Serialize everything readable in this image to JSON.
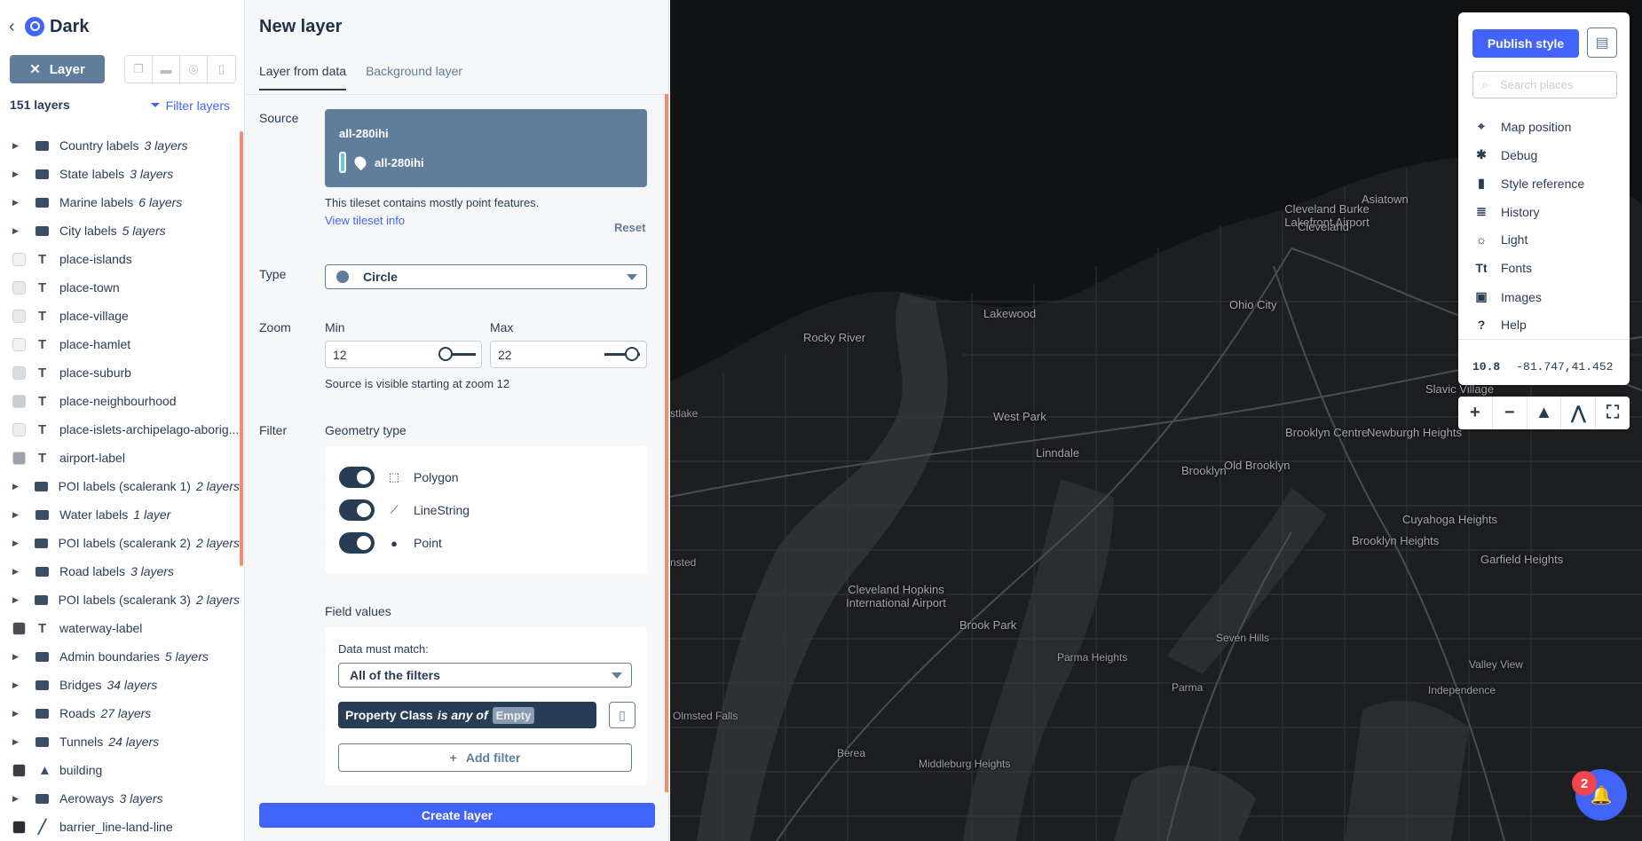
{
  "sidebar": {
    "style_name": "Dark",
    "layer_button": "Layer",
    "layer_count": "151 layers",
    "filter_layers": "Filter layers",
    "layers": [
      {
        "kind": "group",
        "name": "Country labels",
        "count": "3 layers"
      },
      {
        "kind": "group",
        "name": "State labels",
        "count": "3 layers"
      },
      {
        "kind": "group",
        "name": "Marine labels",
        "count": "6 layers"
      },
      {
        "kind": "group",
        "name": "City labels",
        "count": "5 layers"
      },
      {
        "kind": "symbol",
        "name": "place-islands",
        "swatch": "#f1f2f3"
      },
      {
        "kind": "symbol",
        "name": "place-town",
        "swatch": "#e8eaec"
      },
      {
        "kind": "symbol",
        "name": "place-village",
        "swatch": "#e8eaec"
      },
      {
        "kind": "symbol",
        "name": "place-hamlet",
        "swatch": "#f1f2f3"
      },
      {
        "kind": "symbol",
        "name": "place-suburb",
        "swatch": "#d8dbdf"
      },
      {
        "kind": "symbol",
        "name": "place-neighbourhood",
        "swatch": "#c9cdd2"
      },
      {
        "kind": "symbol",
        "name": "place-islets-archipelago-aborig...",
        "swatch": "#eceef0"
      },
      {
        "kind": "symbol",
        "name": "airport-label",
        "swatch": "#9aa3ad"
      },
      {
        "kind": "group",
        "name": "POI labels (scalerank 1)",
        "count": "2 layers"
      },
      {
        "kind": "group",
        "name": "Water labels",
        "count": "1 layer"
      },
      {
        "kind": "group",
        "name": "POI labels (scalerank 2)",
        "count": "2 layers"
      },
      {
        "kind": "group",
        "name": "Road labels",
        "count": "3 layers"
      },
      {
        "kind": "group",
        "name": "POI labels (scalerank 3)",
        "count": "2 layers"
      },
      {
        "kind": "symbol",
        "name": "waterway-label",
        "swatch": "#4a4c50"
      },
      {
        "kind": "group",
        "name": "Admin boundaries",
        "count": "5 layers"
      },
      {
        "kind": "group",
        "name": "Bridges",
        "count": "34 layers"
      },
      {
        "kind": "group",
        "name": "Roads",
        "count": "27 layers"
      },
      {
        "kind": "group",
        "name": "Tunnels",
        "count": "24 layers"
      },
      {
        "kind": "fill-extrusion",
        "name": "building",
        "swatch": "#3a3c40"
      },
      {
        "kind": "group",
        "name": "Aeroways",
        "count": "3 layers"
      },
      {
        "kind": "line",
        "name": "barrier_line-land-line",
        "swatch": "#2b2d31"
      }
    ]
  },
  "panel": {
    "title": "New layer",
    "tabs": [
      "Layer from data",
      "Background layer"
    ],
    "source_label": "Source",
    "source_id": "all-280ihi",
    "source_layer": "all-280ihi",
    "tileset_note": "This tileset contains mostly point features.",
    "view_tileset": "View tileset info",
    "reset": "Reset",
    "type_label": "Type",
    "type_value": "Circle",
    "zoom_label": "Zoom",
    "min_label": "Min",
    "max_label": "Max",
    "min_value": "12",
    "max_value": "22",
    "zoom_note": "Source is visible starting at zoom 12",
    "filter_label": "Filter",
    "geometry_type": "Geometry type",
    "geometries": [
      "Polygon",
      "LineString",
      "Point"
    ],
    "field_values": "Field values",
    "data_must_match": "Data must match:",
    "match_select": "All of the filters",
    "filter_property": "Property Class",
    "filter_op": "is any of",
    "filter_value": "Empty",
    "add_filter": "Add filter",
    "create_layer": "Create layer"
  },
  "menu": {
    "publish": "Publish style",
    "search_placeholder": "Search places",
    "items": [
      {
        "label": "Map position",
        "icon": "crosshair-icon"
      },
      {
        "label": "Debug",
        "icon": "bug-icon"
      },
      {
        "label": "Style reference",
        "icon": "book-icon"
      },
      {
        "label": "History",
        "icon": "history-icon"
      },
      {
        "label": "Light",
        "icon": "sun-icon"
      },
      {
        "label": "Fonts",
        "icon": "fonts-icon"
      },
      {
        "label": "Images",
        "icon": "image-icon"
      },
      {
        "label": "Help",
        "icon": "help-icon"
      }
    ],
    "zoom": "10.8",
    "lnglat": "-81.747,41.452"
  },
  "map": {
    "places": [
      "Cleveland Burke Lakefront Airport",
      "Cleveland",
      "Asiatown",
      "Lakewood",
      "Ohio City",
      "Rocky River",
      "West Park",
      "Linndale",
      "Brooklyn",
      "Old Brooklyn",
      "Brooklyn Centre",
      "Newburgh Heights",
      "Slavic Village",
      "Cleveland Hopkins International Airport",
      "Brooklyn Heights",
      "Cuyahoga Heights",
      "Garfield Heights",
      "Brook Park",
      "Parma Heights",
      "Seven Hills",
      "Parma",
      "Independence",
      "Valley View",
      "Olmsted Falls",
      "Berea",
      "Middleburg Heights",
      "nsted",
      "stlake"
    ]
  },
  "notifications": {
    "count": "2"
  }
}
